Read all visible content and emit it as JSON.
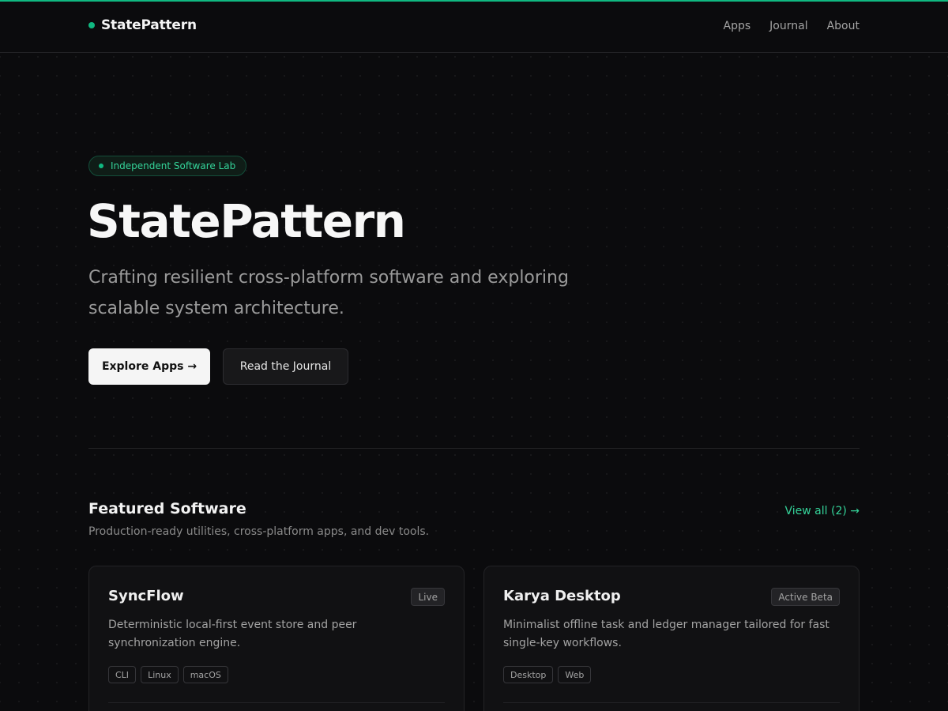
{
  "nav": {
    "brand": "StatePattern",
    "links": [
      "Apps",
      "Journal",
      "About"
    ]
  },
  "hero": {
    "badge": "Independent Software Lab",
    "title": "StatePattern",
    "subtitle": "Crafting resilient cross-platform software and exploring scalable system architecture.",
    "primary_button": "Explore Apps →",
    "secondary_button": "Read the Journal"
  },
  "featured": {
    "title": "Featured Software",
    "subtitle": "Production-ready utilities, cross-platform apps, and dev tools.",
    "view_all": "View all (2) →",
    "cards": [
      {
        "title": "SyncFlow",
        "status": "Live",
        "description": "Deterministic local-first event store and peer synchronization engine.",
        "tags": [
          "CLI",
          "Linux",
          "macOS"
        ]
      },
      {
        "title": "Karya Desktop",
        "status": "Active Beta",
        "description": "Minimalist offline task and ledger manager tailored for fast single-key workflows.",
        "tags": [
          "Desktop",
          "Web"
        ]
      }
    ]
  },
  "colors": {
    "accent": "#10b981",
    "accent_text": "#34d399",
    "background": "#0b0b0d"
  }
}
